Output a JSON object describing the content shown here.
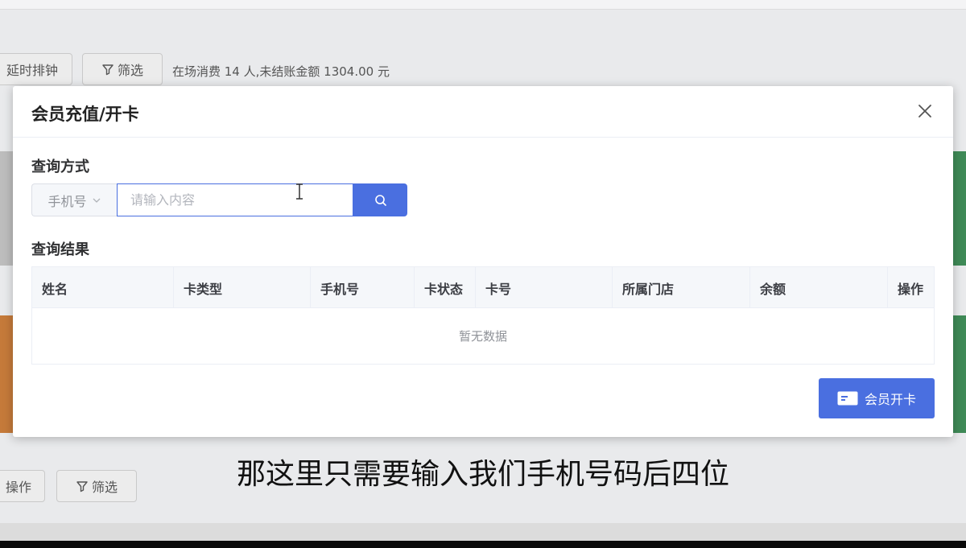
{
  "background": {
    "toolbar": {
      "delay_button_label": "延时排钟",
      "filter_button_label": "筛选",
      "info_text": "在场消费 14 人,未结账金额 1304.00 元"
    },
    "toolbar_bottom": {
      "operate_button_label": "操作",
      "filter_button_label": "筛选"
    }
  },
  "modal": {
    "title": "会员充值/开卡",
    "query_method_label": "查询方式",
    "search_type_value": "手机号",
    "search_placeholder": "请输入内容",
    "search_value": "",
    "results_label": "查询结果",
    "table": {
      "columns": [
        "姓名",
        "卡类型",
        "手机号",
        "卡状态",
        "卡号",
        "所属门店",
        "余额",
        "操作"
      ],
      "empty_text": "暂无数据"
    },
    "open_card_button_label": "会员开卡"
  },
  "subtitle": "那这里只需要输入我们手机号码后四位",
  "colors": {
    "primary": "#4a6fe0",
    "overlay_bg": "#e9eaec"
  }
}
